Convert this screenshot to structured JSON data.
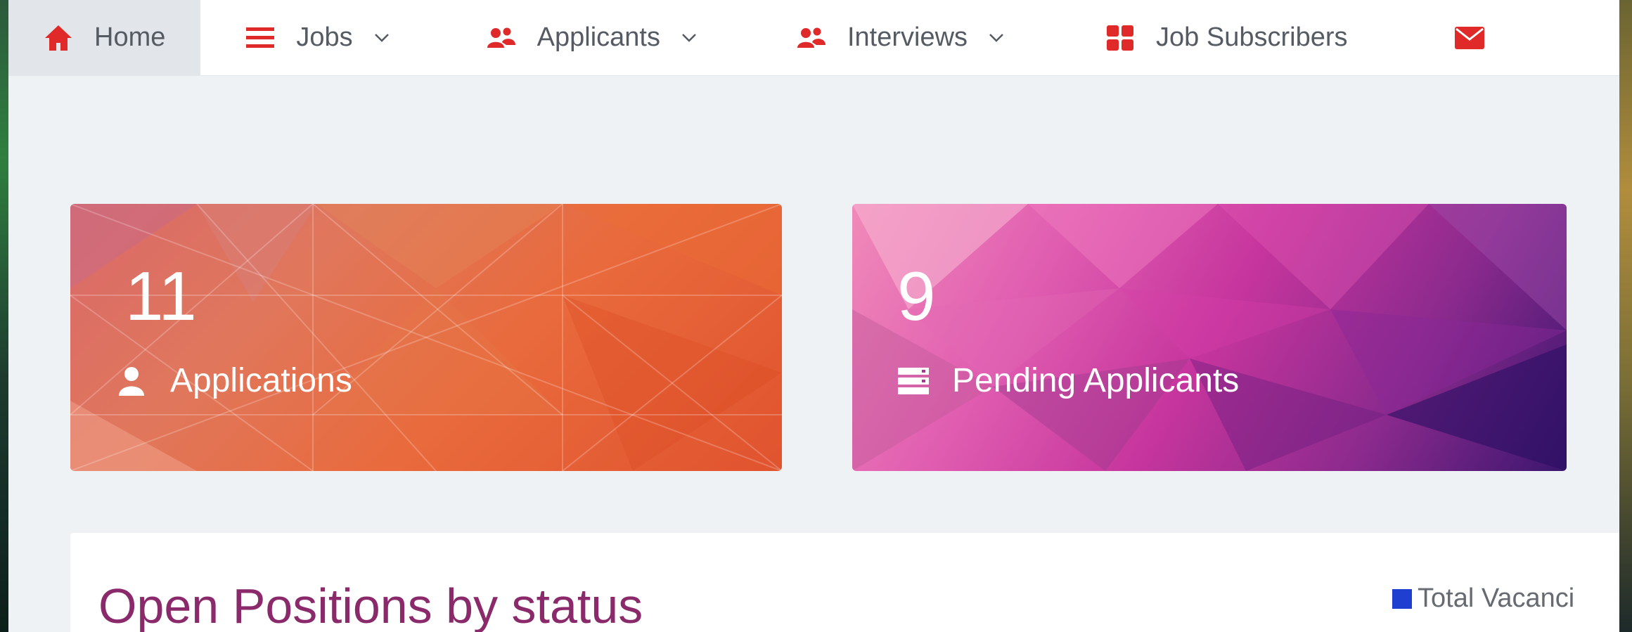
{
  "nav": {
    "items": [
      {
        "label": "Home",
        "icon": "home-icon",
        "has_caret": false,
        "active": true
      },
      {
        "label": "Jobs",
        "icon": "menu-icon",
        "has_caret": true
      },
      {
        "label": "Applicants",
        "icon": "users-icon",
        "has_caret": true
      },
      {
        "label": "Interviews",
        "icon": "users-icon",
        "has_caret": true
      },
      {
        "label": "Job Subscribers",
        "icon": "grid-icon",
        "has_caret": false
      },
      {
        "label": "",
        "icon": "envelope-icon",
        "has_caret": false
      }
    ],
    "icon_color": "#e02a2a"
  },
  "cards": {
    "applications": {
      "count": "11",
      "label": "Applications",
      "icon": "user-icon"
    },
    "pending": {
      "count": "9",
      "label": "Pending Applicants",
      "icon": "server-icon"
    }
  },
  "panel": {
    "title": "Open Positions by status",
    "legend_label": "Total Vacanci",
    "legend_color": "#1f3fd1"
  },
  "colors": {
    "title_color": "#8a2a6b",
    "applications_card": "#e0603a",
    "pending_card": "#b0329a"
  }
}
